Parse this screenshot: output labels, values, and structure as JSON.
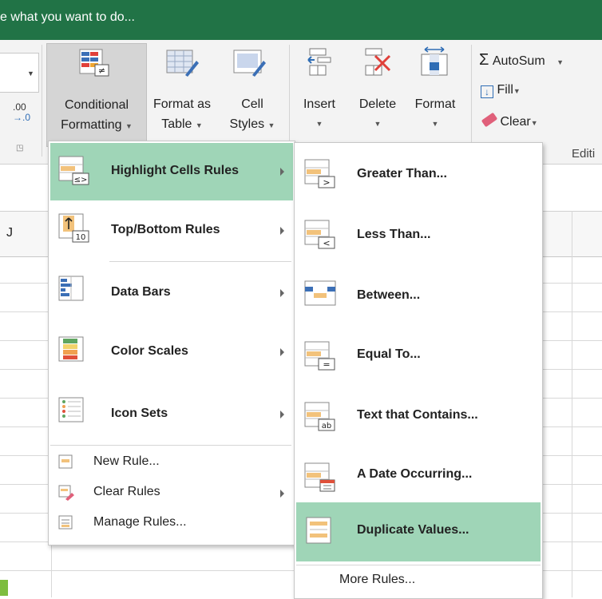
{
  "tellme": {
    "text": "e what you want to do..."
  },
  "ribbon": {
    "dec_label": ".00\n→.0",
    "cond_fmt": {
      "line1": "Conditional",
      "line2": "Formatting"
    },
    "format_table": {
      "line1": "Format as",
      "line2": "Table"
    },
    "cell_styles": {
      "line1": "Cell",
      "line2": "Styles"
    },
    "insert": "Insert",
    "delete": "Delete",
    "format": "Format",
    "autosum": "AutoSum",
    "fill": "Fill",
    "clear": "Clear",
    "editing_group": "Editi",
    "sigma": "Σ"
  },
  "sheet": {
    "col_j": "J"
  },
  "cf_menu": {
    "items": [
      {
        "label": "Highlight Cells Rules",
        "accel": "H"
      },
      {
        "label": "Top/Bottom Rules",
        "accel": "T"
      },
      {
        "label": "Data Bars",
        "accel": "D"
      },
      {
        "label": "Color Scales",
        "accel": "S"
      },
      {
        "label": "Icon Sets",
        "accel": "I"
      }
    ],
    "small": [
      {
        "label": "New Rule..."
      },
      {
        "label": "Clear Rules"
      },
      {
        "label": "Manage Rules..."
      }
    ],
    "icon_text": {
      "top_bottom": "10",
      "highlight": "≤>"
    }
  },
  "sub_menu": {
    "items": [
      {
        "label": "Greater Than...",
        "glyph": ">"
      },
      {
        "label": "Less Than...",
        "glyph": "<"
      },
      {
        "label": "Between...",
        "glyph": ""
      },
      {
        "label": "Equal To...",
        "glyph": "="
      },
      {
        "label": "Text that Contains...",
        "glyph": "ab"
      },
      {
        "label": "A Date Occurring...",
        "glyph": ""
      },
      {
        "label": "Duplicate Values...",
        "glyph": ""
      }
    ],
    "more_rules": "More Rules..."
  },
  "colors": {
    "excel_green": "#217346",
    "highlight": "#9fd5b7",
    "accent_orange": "#f2c27b"
  }
}
